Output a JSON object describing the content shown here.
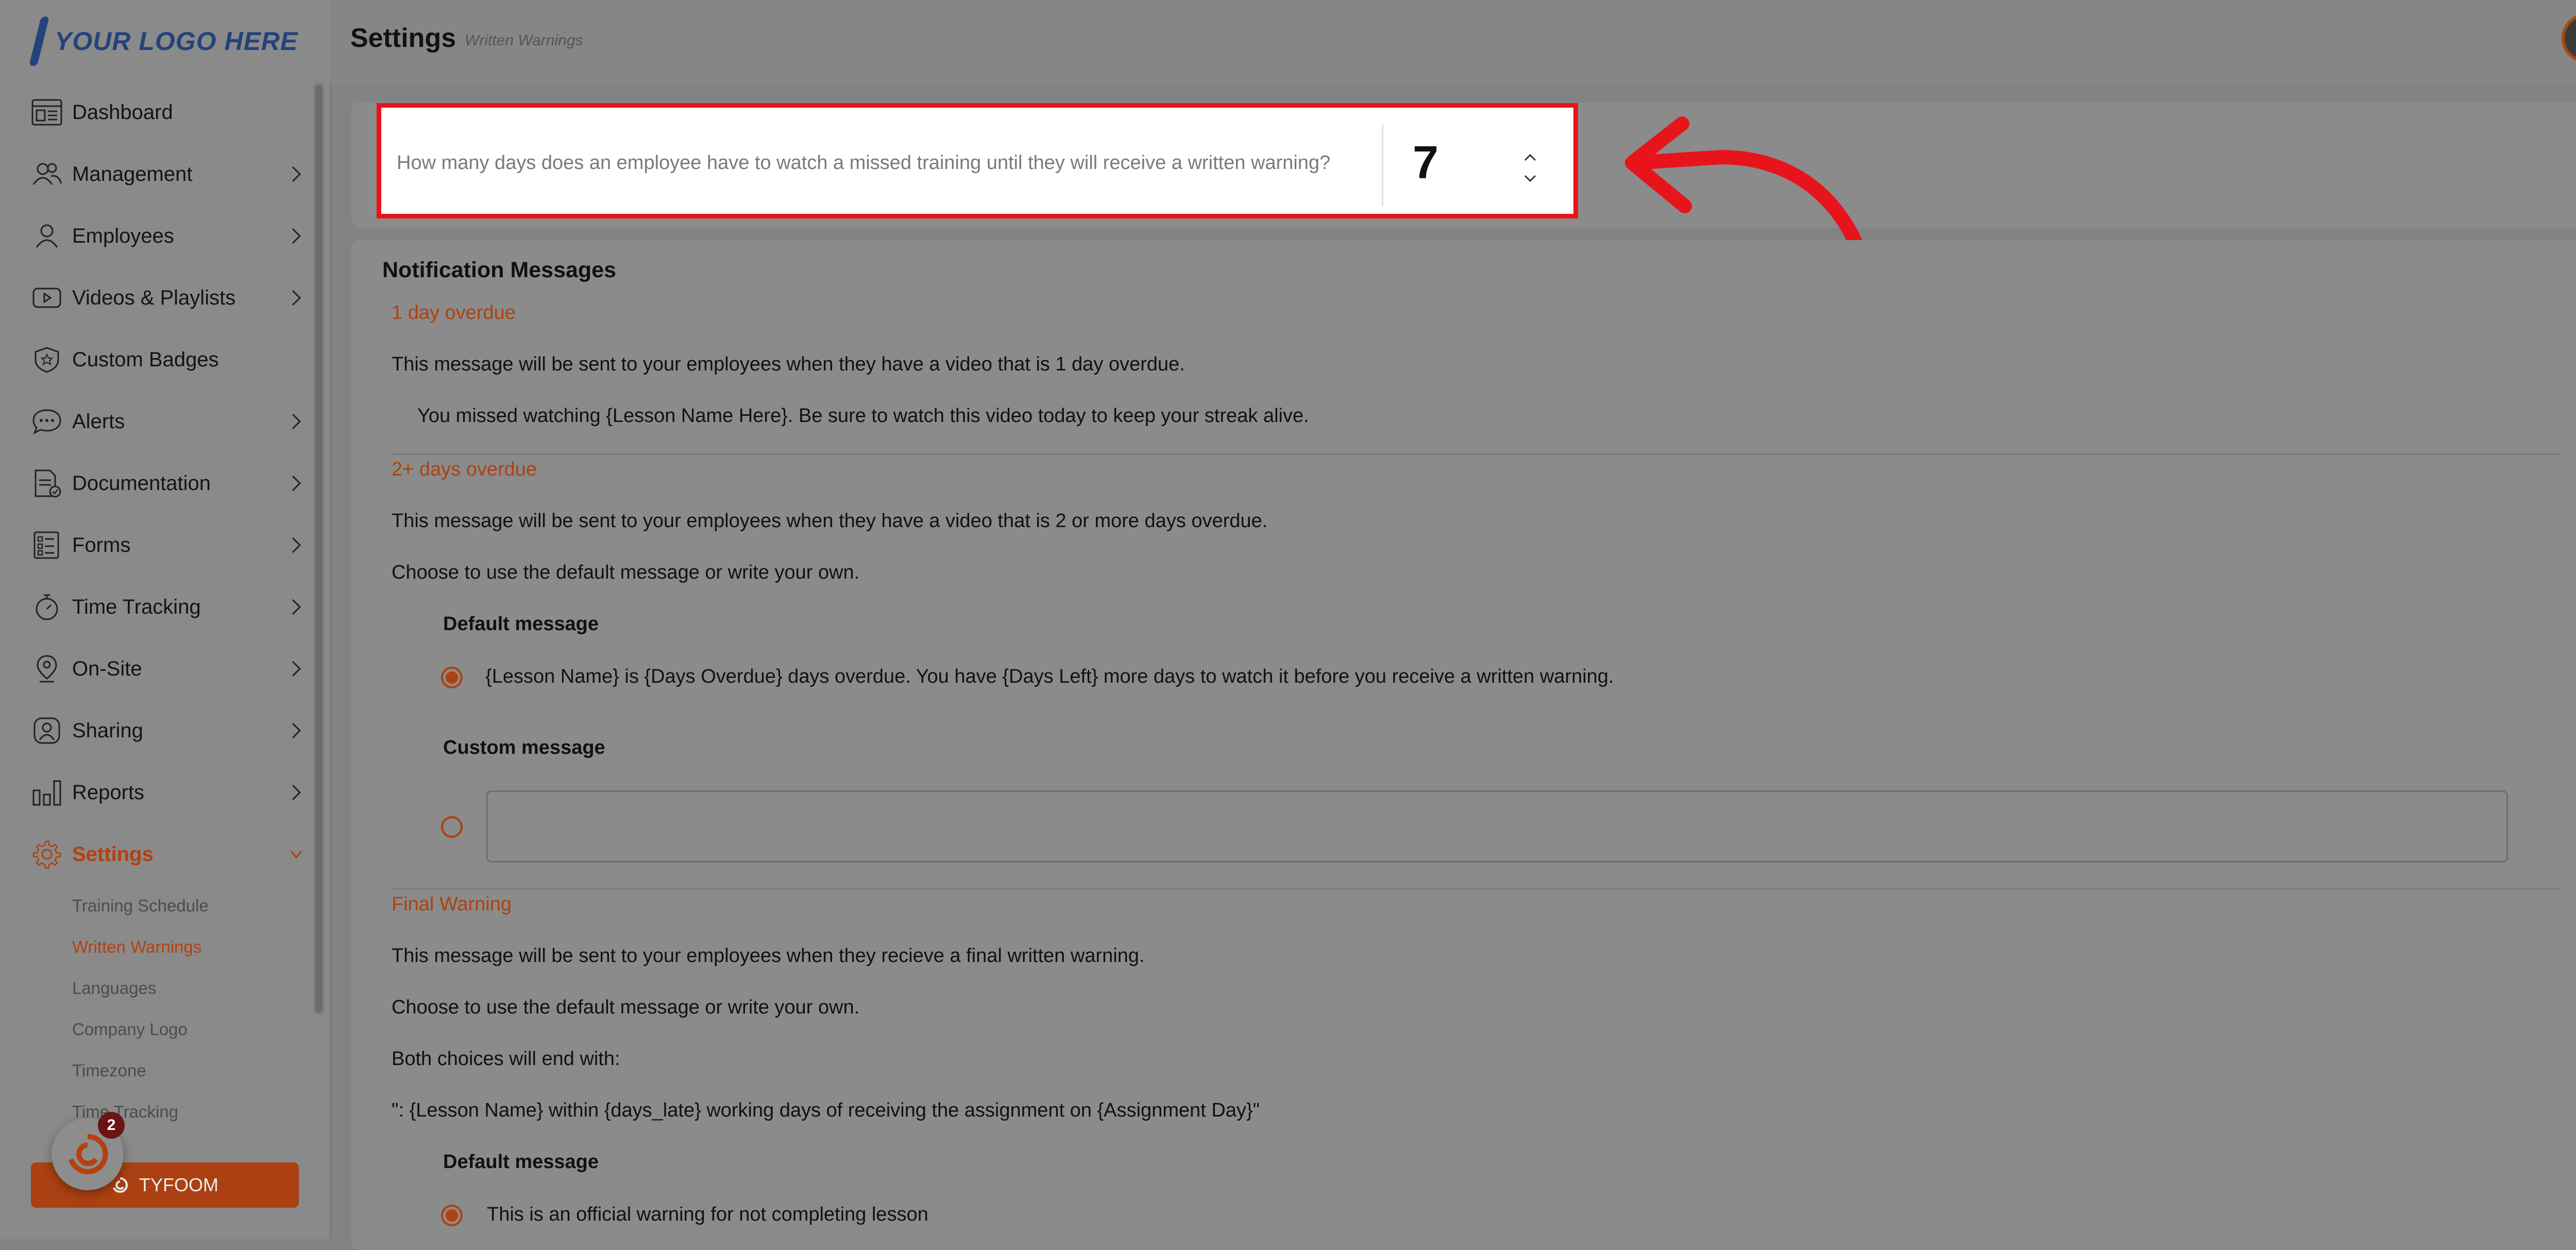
{
  "brand": {
    "logo_text": "YOUR LOGO HERE",
    "accent": "#ad4210",
    "highlight": "#e8141b"
  },
  "header": {
    "title": "Settings",
    "breadcrumb": "Written Warnings"
  },
  "sidebar": {
    "items": [
      {
        "label": "Dashboard",
        "icon": "dashboard-icon"
      },
      {
        "label": "Management",
        "icon": "users-icon"
      },
      {
        "label": "Employees",
        "icon": "person-icon"
      },
      {
        "label": "Videos & Playlists",
        "icon": "video-icon"
      },
      {
        "label": "Custom Badges",
        "icon": "badge-icon"
      },
      {
        "label": "Alerts",
        "icon": "chat-icon"
      },
      {
        "label": "Documentation",
        "icon": "document-icon"
      },
      {
        "label": "Forms",
        "icon": "form-icon"
      },
      {
        "label": "Time Tracking",
        "icon": "stopwatch-icon"
      },
      {
        "label": "On-Site",
        "icon": "location-pin-icon"
      },
      {
        "label": "Sharing",
        "icon": "share-icon"
      },
      {
        "label": "Reports",
        "icon": "bar-chart-icon"
      },
      {
        "label": "Settings",
        "icon": "gear-icon"
      }
    ],
    "settings_sub": [
      "Training Schedule",
      "Written Warnings",
      "Languages",
      "Company Logo",
      "Timezone",
      "Time Tracking"
    ],
    "tyfoom_label": "TYFOOM",
    "notification_count": "2"
  },
  "warning_days": {
    "question": "How many days does an employee have to watch a missed training until they will receive a written warning?",
    "value": "7"
  },
  "notifications": {
    "title": "Notification Messages",
    "one_day": {
      "heading": "1 day overdue",
      "description": "This message will be sent to your employees when they have a video that is 1 day overdue.",
      "message": "You missed watching {Lesson Name Here}. Be sure to watch this video today to keep your streak alive."
    },
    "two_plus": {
      "heading": "2+ days overdue",
      "description": "This message will be sent to your employees when they have a video that is 2 or more days overdue.",
      "choose": "Choose to use the default message or write your own.",
      "default_label": "Default message",
      "default_text": "{Lesson Name} is {Days Overdue} days overdue. You have {Days Left} more days to watch it before you receive a written warning.",
      "custom_label": "Custom message"
    },
    "final": {
      "heading": "Final Warning",
      "description": "This message will be sent to your employees when they recieve a final written warning.",
      "choose": "Choose to use the default message or write your own.",
      "both_end": "Both choices will end with:",
      "suffix": "\": {Lesson Name} within {days_late} working days of receiving the assignment on {Assignment Day}\"",
      "default_label": "Default message",
      "default_text": "This is an official warning for not completing lesson"
    }
  }
}
